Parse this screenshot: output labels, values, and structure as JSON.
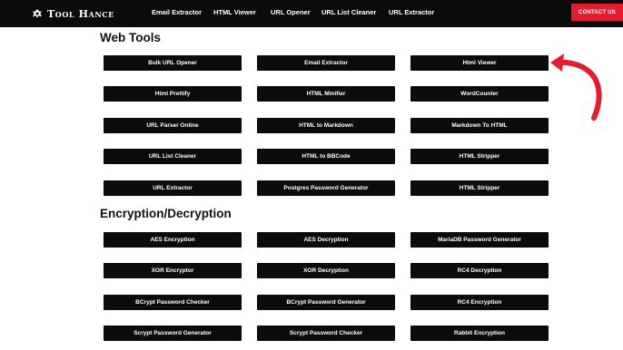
{
  "header": {
    "brand": "Tool Hance",
    "nav": [
      "Email Extractor",
      "HTML Viewer",
      "URL Opener",
      "URL List Cleaner",
      "URL Extractor"
    ],
    "contact_label": "CONTACT US",
    "accent": "#e11d2e"
  },
  "sections": [
    {
      "title": "Web Tools",
      "buttons": [
        "Bulk URL Opener",
        "Email Extractor",
        "Html Viewer",
        "Html Prettify",
        "HTML Minifier",
        "WordCounter",
        "URL Parser Online",
        "HTML to Markdown",
        "Markdown To HTML",
        "URL List Cleaner",
        "HTML to BBCode",
        "HTML Stripper",
        "URL Extractor",
        "Postgres Password Generator",
        "HTML Stripper"
      ]
    },
    {
      "title": "Encryption/Decryption",
      "buttons": [
        "AES Encryption",
        "AES Decryption",
        "MariaDB Password Generator",
        "XOR Encryptor",
        "XOR Decryption",
        "RC4 Decryption",
        "BCrypt Password Checker",
        "BCrypt Password Generator",
        "RC4 Encryption",
        "Scrypt Password Generator",
        "Scrypt Password Checker",
        "Rabbit Encryption"
      ]
    }
  ],
  "annotation": {
    "icon": "curved-arrow-icon",
    "color": "#e11d2e"
  }
}
